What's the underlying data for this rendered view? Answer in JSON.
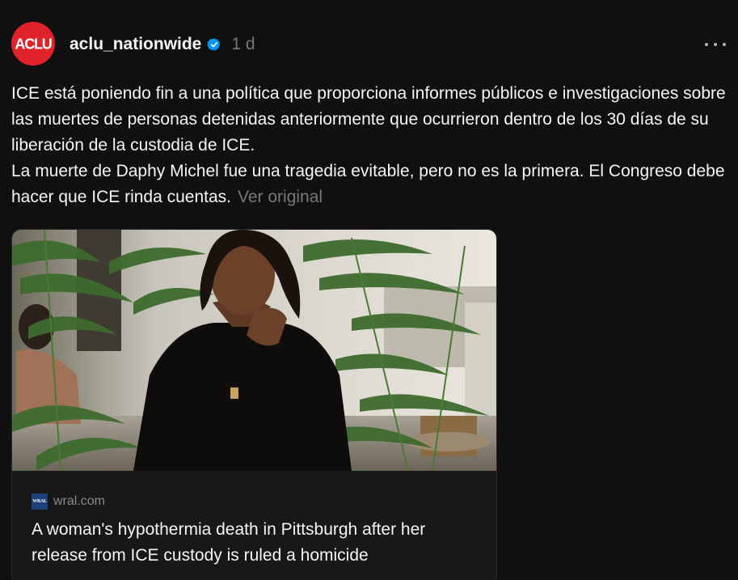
{
  "post": {
    "avatar_text": "ACLU",
    "username": "aclu_nationwide",
    "timestamp": "1 d",
    "body": "ICE está poniendo fin a una política que proporciona informes públicos e investigaciones sobre las muertes de personas detenidas anteriormente que ocurrieron dentro de los 30 días de su liberación de la custodia de ICE.\nLa muerte de Daphy Michel fue una tragedia evitable, pero no es la primera. El Congreso debe hacer que ICE rinda cuentas.",
    "see_original": "Ver original"
  },
  "link_card": {
    "favicon_text": "WRAL",
    "domain": "wral.com",
    "title": "A woman's hypothermia death in Pittsburgh after her release from ICE custody is ruled a homicide"
  },
  "icons": {
    "verified": "verified-badge-icon",
    "more": "more-options-icon"
  },
  "colors": {
    "background": "#101010",
    "avatar": "#e0222a",
    "verified": "#0095f6",
    "muted_text": "#777777"
  }
}
